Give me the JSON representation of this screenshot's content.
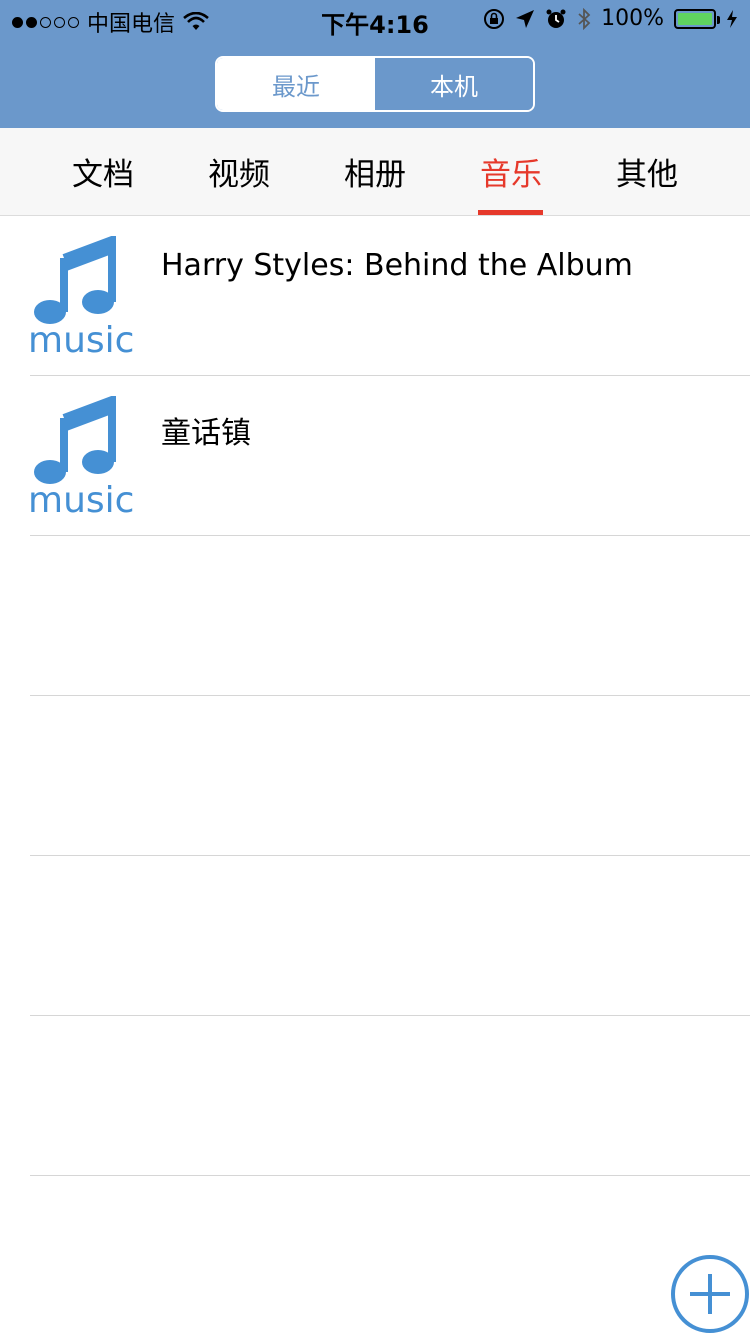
{
  "status_bar": {
    "carrier": "中国电信",
    "time": "下午4:16",
    "battery": "100%",
    "battery_level": 1.0
  },
  "segmented": {
    "recent_label": "最近",
    "local_label": "本机",
    "selected": "本机"
  },
  "tabs": [
    {
      "label": "文档"
    },
    {
      "label": "视频"
    },
    {
      "label": "相册"
    },
    {
      "label": "音乐",
      "active": true
    },
    {
      "label": "其他"
    }
  ],
  "list": {
    "items": [
      {
        "title": "Harry Styles: Behind the Album",
        "icon_label": "music",
        "icon": "music-note-icon"
      },
      {
        "title": "童话镇",
        "icon_label": "music",
        "icon": "music-note-icon"
      }
    ]
  },
  "colors": {
    "header": "#6b98cb",
    "accent_red": "#e6392b",
    "icon_blue": "#4590d4"
  },
  "fab": {
    "icon": "plus-circle-icon"
  }
}
